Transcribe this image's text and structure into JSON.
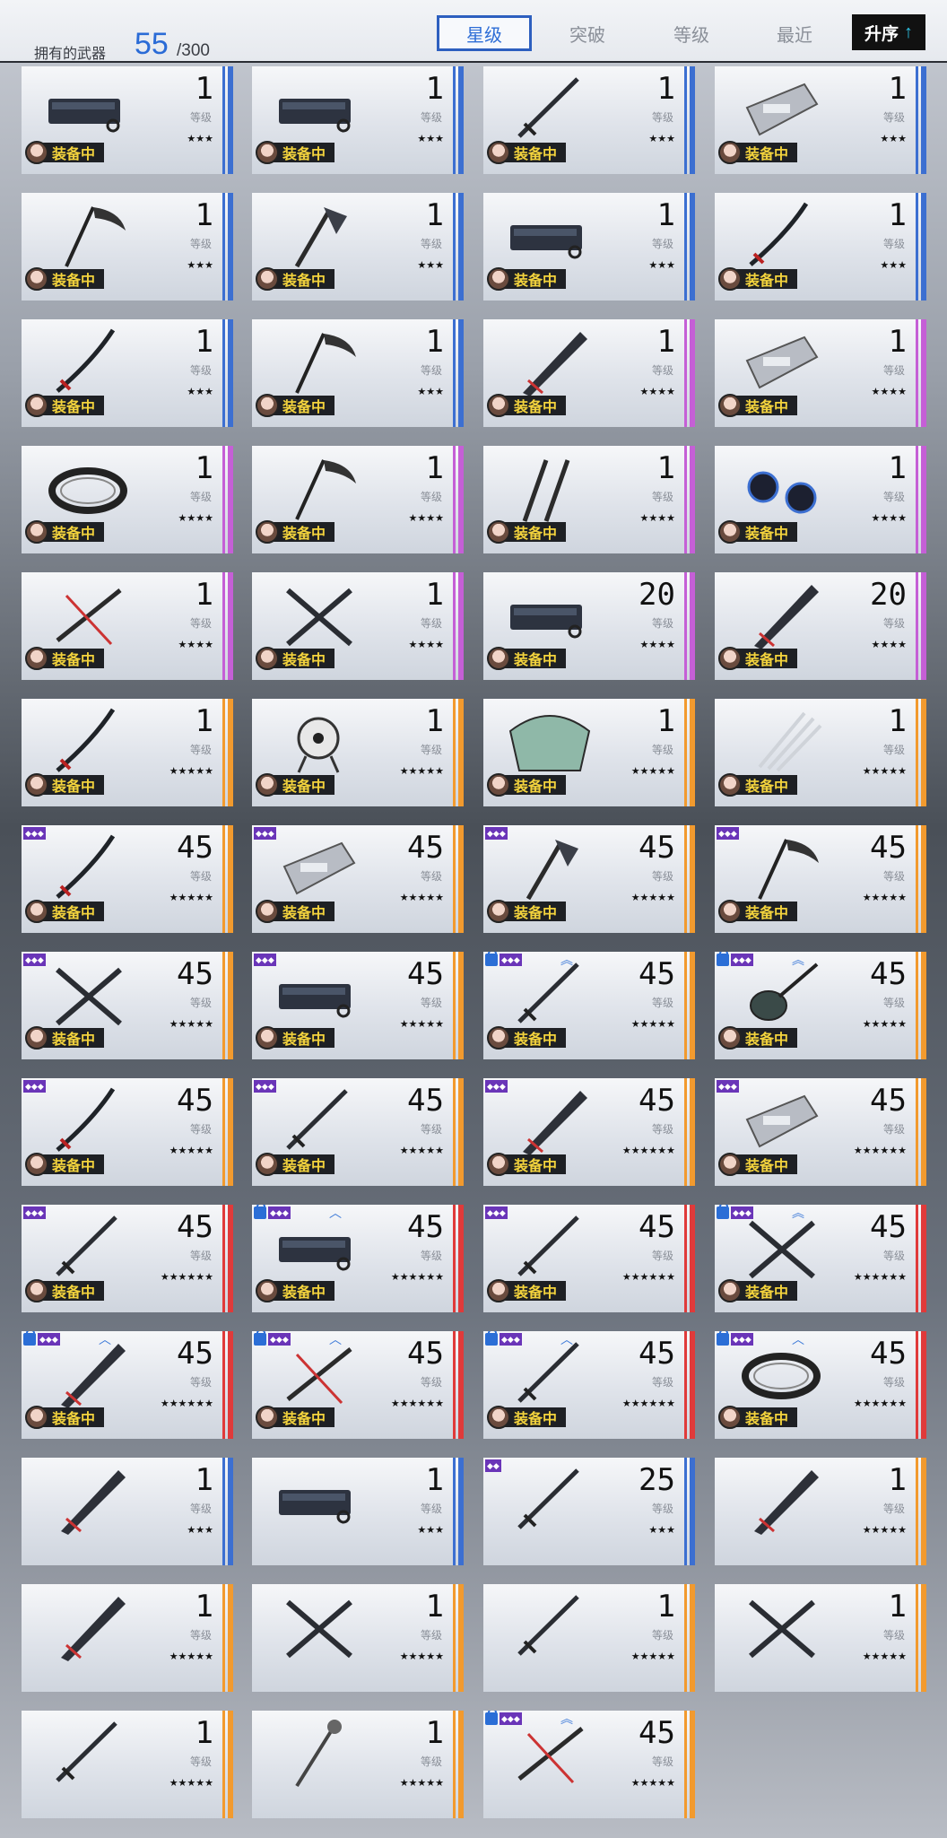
{
  "header": {
    "owned_label": "拥有的武器",
    "owned_count": "55",
    "owned_total": "/300",
    "tabs": [
      {
        "label": "星级",
        "active": true
      },
      {
        "label": "突破",
        "active": false
      },
      {
        "label": "等级",
        "active": false
      },
      {
        "label": "最近",
        "active": false
      }
    ],
    "sort_label": "升序",
    "sort_icon": "arrow-up-icon"
  },
  "common": {
    "level_label": "等级",
    "equipped_label": "装备中"
  },
  "colors": {
    "blue": "#3c6fd1",
    "purple": "#c55fd6",
    "orange": "#f29a2e",
    "red": "#e03a3a",
    "accent": "#2d6dd6",
    "equip_text": "#f3d33d"
  },
  "weapons": [
    {
      "level": "1",
      "stars": "★★★",
      "rarity": "blue",
      "equipped": true,
      "weapon": "cannon"
    },
    {
      "level": "1",
      "stars": "★★★",
      "rarity": "blue",
      "equipped": true,
      "weapon": "cannon"
    },
    {
      "level": "1",
      "stars": "★★★",
      "rarity": "blue",
      "equipped": true,
      "weapon": "sword"
    },
    {
      "level": "1",
      "stars": "★★★",
      "rarity": "blue",
      "equipped": true,
      "weapon": "gauntlet"
    },
    {
      "level": "1",
      "stars": "★★★",
      "rarity": "blue",
      "equipped": true,
      "weapon": "scythe"
    },
    {
      "level": "1",
      "stars": "★★★",
      "rarity": "blue",
      "equipped": true,
      "weapon": "axe"
    },
    {
      "level": "1",
      "stars": "★★★",
      "rarity": "blue",
      "equipped": true,
      "weapon": "cannon"
    },
    {
      "level": "1",
      "stars": "★★★",
      "rarity": "blue",
      "equipped": true,
      "weapon": "katana"
    },
    {
      "level": "1",
      "stars": "★★★",
      "rarity": "blue",
      "equipped": true,
      "weapon": "katana"
    },
    {
      "level": "1",
      "stars": "★★★",
      "rarity": "blue",
      "equipped": true,
      "weapon": "scythe"
    },
    {
      "level": "1",
      "stars": "★★★★",
      "rarity": "purple",
      "equipped": true,
      "weapon": "greatsword"
    },
    {
      "level": "1",
      "stars": "★★★★",
      "rarity": "purple",
      "equipped": true,
      "weapon": "gauntlet"
    },
    {
      "level": "1",
      "stars": "★★★★",
      "rarity": "purple",
      "equipped": true,
      "weapon": "ring"
    },
    {
      "level": "1",
      "stars": "★★★★",
      "rarity": "purple",
      "equipped": true,
      "weapon": "scythe"
    },
    {
      "level": "1",
      "stars": "★★★★",
      "rarity": "purple",
      "equipped": true,
      "weapon": "blades"
    },
    {
      "level": "1",
      "stars": "★★★★",
      "rarity": "purple",
      "equipped": true,
      "weapon": "orbs"
    },
    {
      "level": "1",
      "stars": "★★★★",
      "rarity": "purple",
      "equipped": true,
      "weapon": "dualblade"
    },
    {
      "level": "1",
      "stars": "★★★★",
      "rarity": "purple",
      "equipped": true,
      "weapon": "cross"
    },
    {
      "level": "20",
      "stars": "★★★★",
      "rarity": "purple",
      "equipped": true,
      "weapon": "cannon"
    },
    {
      "level": "20",
      "stars": "★★★★",
      "rarity": "purple",
      "equipped": true,
      "weapon": "greatsword"
    },
    {
      "level": "1",
      "stars": "★★★★★",
      "rarity": "orange",
      "equipped": true,
      "weapon": "katana"
    },
    {
      "level": "1",
      "stars": "★★★★★",
      "rarity": "orange",
      "equipped": true,
      "weapon": "drone"
    },
    {
      "level": "1",
      "stars": "★★★★★",
      "rarity": "orange",
      "equipped": true,
      "weapon": "fan"
    },
    {
      "level": "1",
      "stars": "★★★★★",
      "rarity": "orange",
      "equipped": true,
      "weapon": "claw"
    },
    {
      "level": "45",
      "stars": "★★★★★",
      "rarity": "orange",
      "equipped": true,
      "weapon": "katana",
      "rank": "◆◆◆"
    },
    {
      "level": "45",
      "stars": "★★★★★",
      "rarity": "orange",
      "equipped": true,
      "weapon": "gauntlet",
      "rank": "◆◆◆"
    },
    {
      "level": "45",
      "stars": "★★★★★",
      "rarity": "orange",
      "equipped": true,
      "weapon": "axe",
      "rank": "◆◆◆"
    },
    {
      "level": "45",
      "stars": "★★★★★",
      "rarity": "orange",
      "equipped": true,
      "weapon": "scythe",
      "rank": "◆◆◆"
    },
    {
      "level": "45",
      "stars": "★★★★★",
      "rarity": "orange",
      "equipped": true,
      "weapon": "cross",
      "rank": "◆◆◆"
    },
    {
      "level": "45",
      "stars": "★★★★★",
      "rarity": "orange",
      "equipped": true,
      "weapon": "cannon",
      "rank": "◆◆◆"
    },
    {
      "level": "45",
      "stars": "★★★★★",
      "rarity": "orange",
      "equipped": true,
      "weapon": "sword",
      "rank": "◆◆◆",
      "locked": true,
      "chevron": "︽"
    },
    {
      "level": "45",
      "stars": "★★★★★",
      "rarity": "orange",
      "equipped": true,
      "weapon": "lute",
      "rank": "◆◆◆",
      "locked": true,
      "chevron": "︽"
    },
    {
      "level": "45",
      "stars": "★★★★★",
      "rarity": "orange",
      "equipped": true,
      "weapon": "katana",
      "rank": "◆◆◆"
    },
    {
      "level": "45",
      "stars": "★★★★★",
      "rarity": "orange",
      "equipped": true,
      "weapon": "sword",
      "rank": "◆◆◆"
    },
    {
      "level": "45",
      "stars": "★★★★★★",
      "rarity": "orange",
      "equipped": true,
      "weapon": "greatsword",
      "rank": "◆◆◆"
    },
    {
      "level": "45",
      "stars": "★★★★★★",
      "rarity": "orange",
      "equipped": true,
      "weapon": "gauntlet",
      "rank": "◆◆◆"
    },
    {
      "level": "45",
      "stars": "★★★★★★",
      "rarity": "red",
      "equipped": true,
      "weapon": "sword",
      "rank": "◆◆◆"
    },
    {
      "level": "45",
      "stars": "★★★★★★",
      "rarity": "red",
      "equipped": true,
      "weapon": "cannon",
      "rank": "◆◆◆",
      "locked": true,
      "chevron": "︿"
    },
    {
      "level": "45",
      "stars": "★★★★★★",
      "rarity": "red",
      "equipped": true,
      "weapon": "sword",
      "rank": "◆◆◆"
    },
    {
      "level": "45",
      "stars": "★★★★★★",
      "rarity": "red",
      "equipped": true,
      "weapon": "cross",
      "rank": "◆◆◆",
      "locked": true,
      "chevron": "︽"
    },
    {
      "level": "45",
      "stars": "★★★★★★",
      "rarity": "red",
      "equipped": true,
      "weapon": "greatsword",
      "rank": "◆◆◆",
      "locked": true,
      "chevron": "︿"
    },
    {
      "level": "45",
      "stars": "★★★★★★",
      "rarity": "red",
      "equipped": true,
      "weapon": "dualblade",
      "rank": "◆◆◆",
      "locked": true,
      "chevron": "︿"
    },
    {
      "level": "45",
      "stars": "★★★★★★",
      "rarity": "red",
      "equipped": true,
      "weapon": "sword",
      "rank": "◆◆◆",
      "locked": true,
      "chevron": "︿"
    },
    {
      "level": "45",
      "stars": "★★★★★★",
      "rarity": "red",
      "equipped": true,
      "weapon": "ring",
      "rank": "◆◆◆",
      "locked": true,
      "chevron": "︿"
    },
    {
      "level": "1",
      "stars": "★★★",
      "rarity": "blue",
      "equipped": false,
      "weapon": "greatsword"
    },
    {
      "level": "1",
      "stars": "★★★",
      "rarity": "blue",
      "equipped": false,
      "weapon": "cannon"
    },
    {
      "level": "25",
      "stars": "★★★",
      "rarity": "blue",
      "equipped": false,
      "weapon": "sword",
      "rank": "◆◆"
    },
    {
      "level": "1",
      "stars": "★★★★★",
      "rarity": "orange",
      "equipped": false,
      "weapon": "greatsword"
    },
    {
      "level": "1",
      "stars": "★★★★★",
      "rarity": "orange",
      "equipped": false,
      "weapon": "greatsword"
    },
    {
      "level": "1",
      "stars": "★★★★★",
      "rarity": "orange",
      "equipped": false,
      "weapon": "cross"
    },
    {
      "level": "1",
      "stars": "★★★★★",
      "rarity": "orange",
      "equipped": false,
      "weapon": "sword"
    },
    {
      "level": "1",
      "stars": "★★★★★",
      "rarity": "orange",
      "equipped": false,
      "weapon": "cross"
    },
    {
      "level": "1",
      "stars": "★★★★★",
      "rarity": "orange",
      "equipped": false,
      "weapon": "sword"
    },
    {
      "level": "1",
      "stars": "★★★★★",
      "rarity": "orange",
      "equipped": false,
      "weapon": "mace"
    },
    {
      "level": "45",
      "stars": "★★★★★",
      "rarity": "orange",
      "equipped": false,
      "weapon": "dualblade",
      "rank": "◆◆◆",
      "locked": true,
      "chevron": "︽"
    }
  ]
}
